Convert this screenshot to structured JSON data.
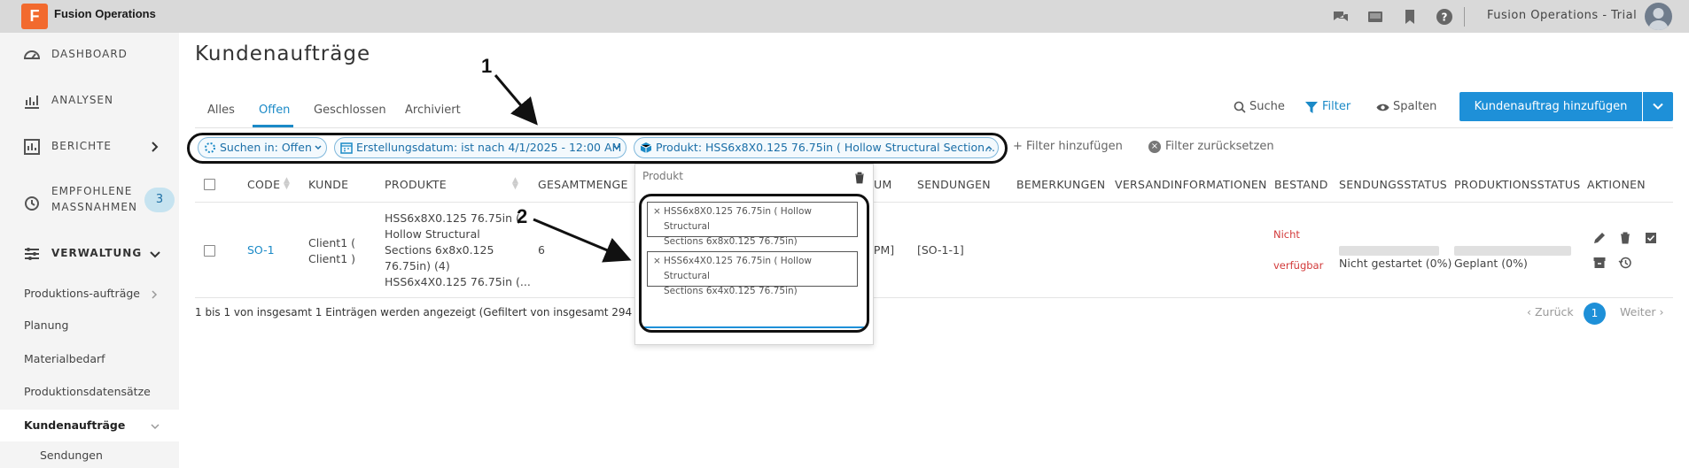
{
  "app": {
    "logo_letter": "F",
    "name": "Fusion Operations",
    "tenant": "Fusion Operations - Trial"
  },
  "topbar_icons": [
    "chat-icon",
    "monitor-icon",
    "bookmark-icon",
    "help-icon"
  ],
  "sidebar": {
    "items": [
      {
        "label": "DASHBOARD",
        "icon": "gauge-icon"
      },
      {
        "label": "ANALYSEN",
        "icon": "chart-icon"
      },
      {
        "label": "BERICHTE",
        "icon": "report-icon"
      },
      {
        "label": "EMPFOHLENE",
        "label2": "MASSNAHMEN",
        "icon": "history-icon",
        "badge": "3"
      },
      {
        "label": "VERWALTUNG",
        "icon": "sliders-icon"
      }
    ],
    "subitems": [
      "Produktions-aufträge",
      "Planung",
      "Materialbedarf",
      "Produktionsdatensätze",
      "Kundenaufträge",
      "Sendungen"
    ]
  },
  "page": {
    "title": "Kundenaufträge"
  },
  "tabs": [
    "Alles",
    "Offen",
    "Geschlossen",
    "Archiviert"
  ],
  "active_tab": "Offen",
  "toolbar": {
    "search": "Suche",
    "filter": "Filter",
    "columns": "Spalten",
    "add": "Kundenauftrag hinzufügen"
  },
  "filters": {
    "chips": [
      "Suchen in: Offen",
      "Erstellungsdatum: ist nach 4/1/2025 - 12:00 AM",
      "Produkt: HSS6x8X0.125 76.75in ( Hollow Structural Section..."
    ],
    "add": "+ Filter hinzufügen",
    "reset": "Filter zurücksetzen"
  },
  "table": {
    "headers": [
      "CODE",
      "KUNDE",
      "PRODUKTE",
      "GESAMTMENGE",
      "UM",
      "SENDUNGEN",
      "BEMERKUNGEN",
      "VERSANDINFORMATIONEN",
      "BESTAND",
      "SENDUNGSSTATUS",
      "PRODUKTIONSSTATUS",
      "AKTIONEN"
    ],
    "rows": [
      {
        "code": "SO-1",
        "kunde": [
          "Client1 (",
          "Client1 )"
        ],
        "produkte": [
          "HSS6x8X0.125 76.75in (",
          "Hollow Structural",
          "Sections 6x8x0.125",
          "76.75in) (4)",
          "HSS6x4X0.125 76.75in (..."
        ],
        "menge": "6",
        "datum_fragment": "0 PM]",
        "sendungen": "[SO-1-1]",
        "bestand": [
          "Nicht",
          "verfügbar"
        ],
        "sendungsstatus": "Nicht gestartet (0%)",
        "produktionsstatus": "Geplant (0%)"
      }
    ]
  },
  "footer": {
    "info": "1 bis 1 von insgesamt 1 Einträgen werden angezeigt (Gefiltert von insgesamt 294 Einträgen)",
    "prev": "‹ Zurück",
    "page": "1",
    "next": "Weiter ›"
  },
  "popup": {
    "label": "Produkt",
    "tags": [
      [
        "HSS6x8X0.125 76.75in ( Hollow Structural",
        "Sections 6x8x0.125 76.75in)"
      ],
      [
        "HSS6x4X0.125 76.75in ( Hollow Structural",
        "Sections 6x4x0.125 76.75in)"
      ]
    ]
  },
  "annotations": {
    "one": "1",
    "two": "2"
  },
  "colors": {
    "accent": "#1e90d8",
    "logo": "#f26a2e",
    "topbar": "#d9d9d9",
    "sidebar": "#f4f4f4",
    "warning": "#d23a3a"
  }
}
